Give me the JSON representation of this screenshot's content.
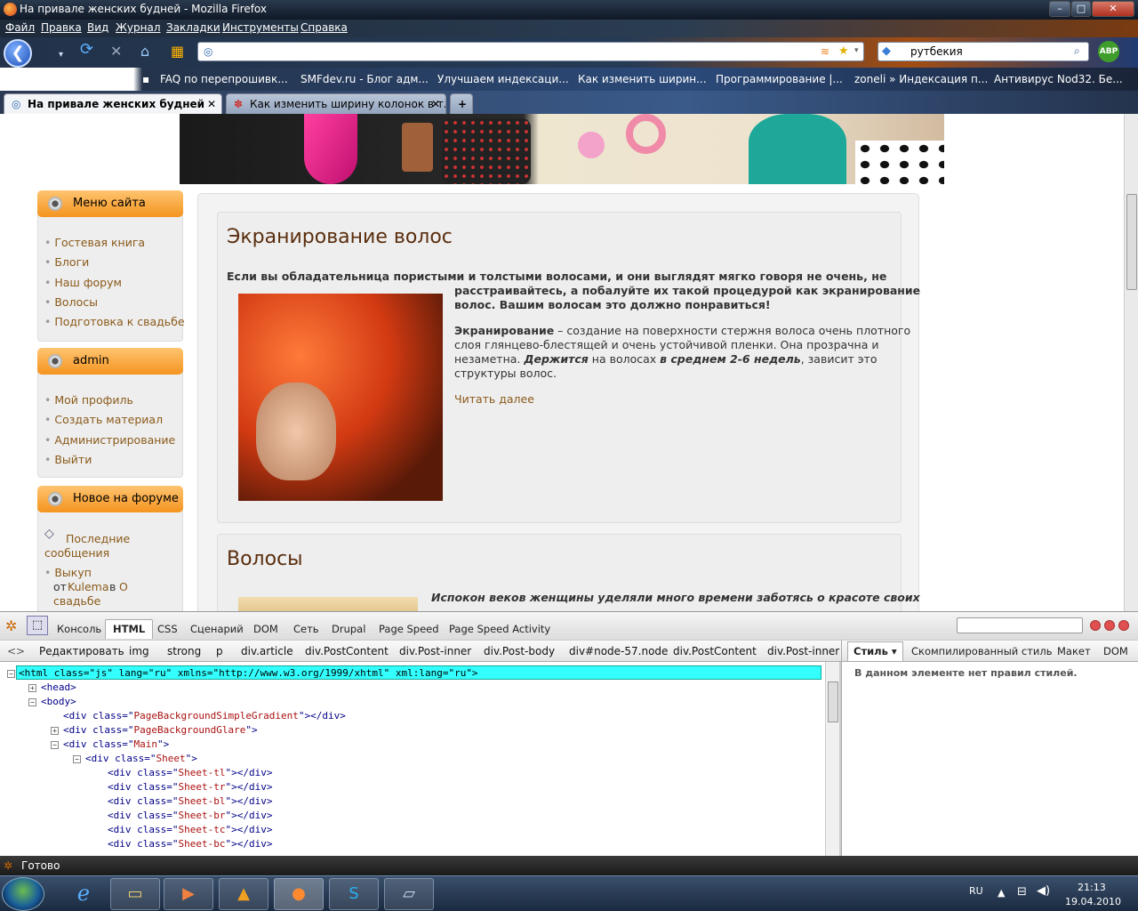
{
  "window": {
    "title": "На привале женских будней - Mozilla Firefox",
    "min": "–",
    "max": "□",
    "close": "✕"
  },
  "menu": [
    "Файл",
    "Правка",
    "Вид",
    "Журнал",
    "Закладки",
    "Инструменты",
    "Справка"
  ],
  "search": {
    "value": "рутбекия"
  },
  "abp": "ABP",
  "bookmarks": [
    "FAQ по перепрошивк...",
    "SMFdev.ru - Блог адм...",
    "Улучшаем индексаци...",
    "Как изменить ширин...",
    "Программирование |...",
    "zoneli » Индексация п...",
    "Антивирус Nod32. Бе..."
  ],
  "tabs": [
    {
      "label": "На привале женских будней",
      "close": "✕"
    },
    {
      "label": "Как изменить ширину колонок в т...",
      "close": "✕"
    }
  ],
  "newtab": "+",
  "sidebar": {
    "menu_title": "Меню сайта",
    "menu_items": [
      "Гостевая книга",
      "Блоги",
      "Наш форум",
      "Волосы",
      "Подготовка к свадьбе"
    ],
    "user_title": "admin",
    "user_items": [
      "Мой профиль",
      "Создать материал",
      "Администрирование",
      "Выйти"
    ],
    "forum_title": "Новое на форуме",
    "forum_latest": "Последние сообщения",
    "forum_topic": "Выкуп",
    "forum_from": "от",
    "forum_author": "Kulema",
    "forum_in": "в",
    "forum_board": "О свадьбе"
  },
  "article1": {
    "title": "Экранирование волос",
    "intro_a": "Если вы обладательница пористыми и толстыми волосами, и они выглядят мягко говоря не очень, не",
    "intro_b": "расстраивайтесь, а побалуйте их такой процедурой как экранирование",
    "intro_c": "волос. Вашим волосам это должно понравиться!",
    "body_term": "Экранирование",
    "body_1": " – создание на поверхности стержня волоса очень плотного",
    "body_2": "слоя глянцево-блестящей и очень устойчивой пленки. Она прозрачна и",
    "body_3a": "незаметна. ",
    "body_3b": "Держится",
    "body_3c": " на волосах ",
    "body_3d": "в среднем 2-6 недель",
    "body_3e": ", зависит это",
    "body_4": "структуры волос.",
    "read_more": "Читать далее"
  },
  "article2": {
    "title": "Волосы",
    "intro": "Испокон веков женщины уделяли много времени заботясь о красоте своих"
  },
  "firebug": {
    "tabs": [
      "Консоль",
      "HTML",
      "CSS",
      "Сценарий",
      "DOM",
      "Сеть",
      "Drupal",
      "Page Speed",
      "Page Speed Activity"
    ],
    "edit": "Редактировать",
    "crumbs": [
      "img",
      "strong",
      "p",
      "div.article",
      "div.PostContent",
      "div.Post-inner",
      "div.Post-body",
      "div#node-57.node",
      "div.PostContent",
      "div.Post-inner"
    ],
    "side_tabs": [
      "Стиль ▾",
      "Скомпилированный стиль",
      "Макет",
      "DOM"
    ],
    "no_rules": "В данном элементе нет правил стилей.",
    "html_lines": [
      {
        "text": "<html class=\"js\" lang=\"ru\" xmlns=\"http://www.w3.org/1999/xhtml\" xml:lang=\"ru\">"
      },
      {
        "text": "<head>"
      },
      {
        "text": "<body>"
      },
      {
        "tag": "div",
        "cls": "PageBackgroundSimpleGradient",
        "close": "></div>"
      },
      {
        "tag": "div",
        "cls": "PageBackgroundGlare",
        "close": ">"
      },
      {
        "tag": "div",
        "cls": "Main",
        "close": ">"
      },
      {
        "tag": "div",
        "cls": "Sheet",
        "close": ">"
      },
      {
        "tag": "div",
        "cls": "Sheet-tl",
        "close": "></div>"
      },
      {
        "tag": "div",
        "cls": "Sheet-tr",
        "close": "></div>"
      },
      {
        "tag": "div",
        "cls": "Sheet-bl",
        "close": "></div>"
      },
      {
        "tag": "div",
        "cls": "Sheet-br",
        "close": "></div>"
      },
      {
        "tag": "div",
        "cls": "Sheet-tc",
        "close": "></div>"
      },
      {
        "tag": "div",
        "cls": "Sheet-bc",
        "close": "></div>"
      }
    ]
  },
  "status": "Готово",
  "tray": {
    "lang": "RU",
    "time": "21:13",
    "date": "19.04.2010"
  }
}
